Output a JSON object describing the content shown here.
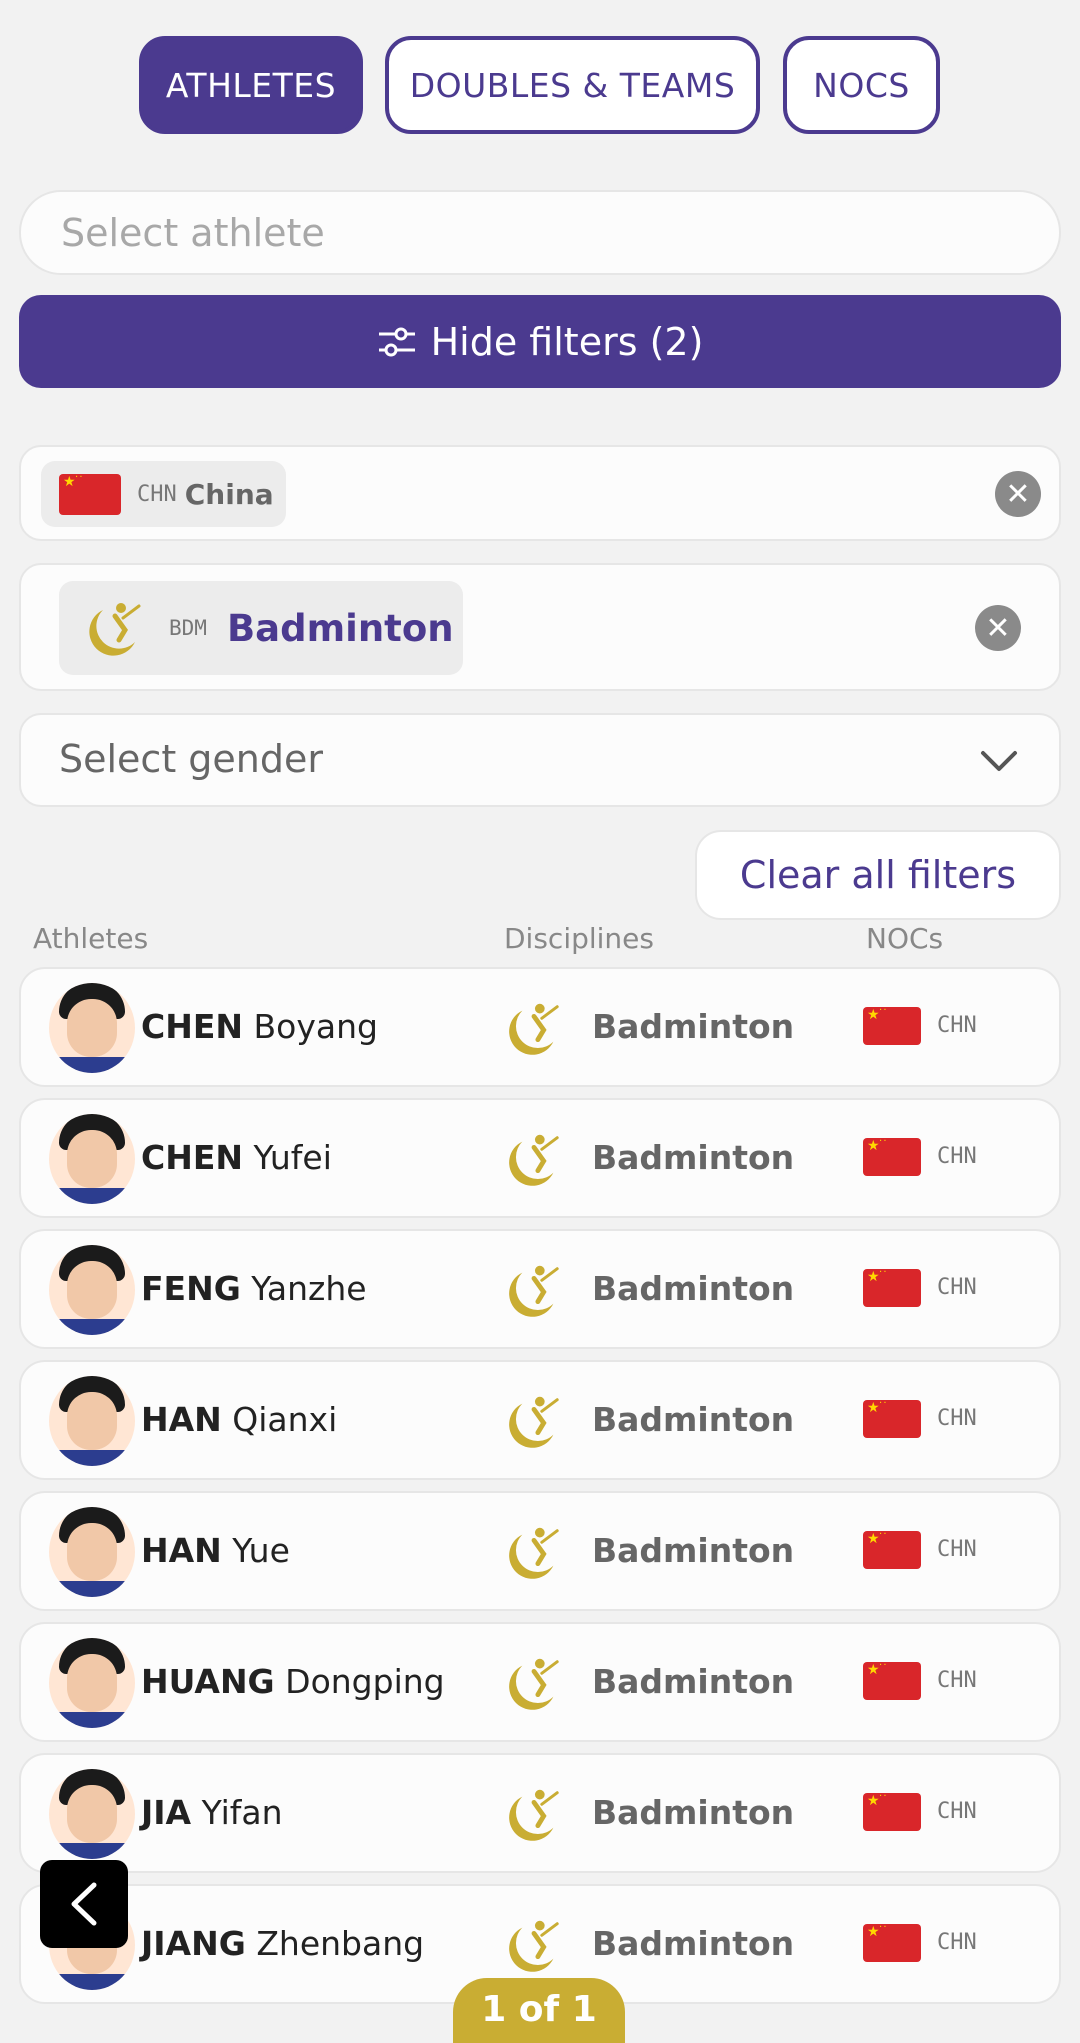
{
  "tabs": [
    {
      "label": "ATHLETES",
      "active": true
    },
    {
      "label": "DOUBLES & TEAMS",
      "active": false
    },
    {
      "label": "NOCS",
      "active": false
    }
  ],
  "search": {
    "placeholder": "Select athlete"
  },
  "filters_toggle": {
    "label": "Hide filters (2)",
    "icon": "sliders-icon"
  },
  "active_filters": {
    "noc": {
      "code": "CHN",
      "name": "China",
      "flag": "china-flag"
    },
    "discipline": {
      "code": "BDM",
      "name": "Badminton",
      "icon": "badminton-icon"
    }
  },
  "gender": {
    "placeholder": "Select gender"
  },
  "clear_all": {
    "label": "Clear all filters"
  },
  "columns": {
    "athletes": "Athletes",
    "disciplines": "Disciplines",
    "nocs": "NOCs"
  },
  "athletes": [
    {
      "last": "CHEN",
      "first": "Boyang",
      "discipline": "Badminton",
      "noc": "CHN"
    },
    {
      "last": "CHEN",
      "first": "Yufei",
      "discipline": "Badminton",
      "noc": "CHN"
    },
    {
      "last": "FENG",
      "first": "Yanzhe",
      "discipline": "Badminton",
      "noc": "CHN"
    },
    {
      "last": "HAN",
      "first": "Qianxi",
      "discipline": "Badminton",
      "noc": "CHN"
    },
    {
      "last": "HAN",
      "first": "Yue",
      "discipline": "Badminton",
      "noc": "CHN"
    },
    {
      "last": "HUANG",
      "first": "Dongping",
      "discipline": "Badminton",
      "noc": "CHN"
    },
    {
      "last": "JIA",
      "first": "Yifan",
      "discipline": "Badminton",
      "noc": "CHN"
    },
    {
      "last": "JIANG",
      "first": "Zhenbang",
      "discipline": "Badminton",
      "noc": "CHN"
    }
  ],
  "pager": {
    "label": "1 of 1"
  },
  "colors": {
    "primary": "#4b3a8f",
    "gold": "#c9ad33",
    "flag_red": "#d9262a"
  }
}
